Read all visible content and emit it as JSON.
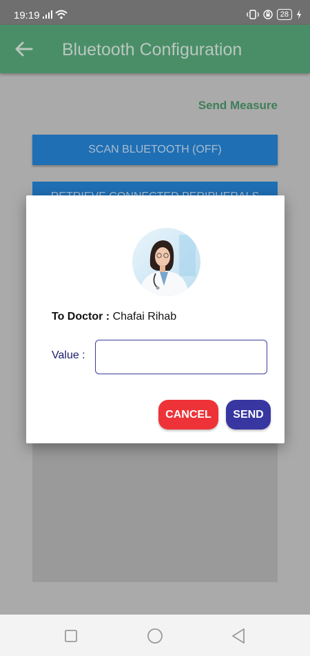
{
  "status_bar": {
    "time": "19:19",
    "battery": "28"
  },
  "app_bar": {
    "title": "Bluetooth Configuration",
    "back_icon": "arrow-left-icon",
    "color": "#4a8e68"
  },
  "screen": {
    "send_measure": "Send Measure",
    "scan_button": "SCAN BLUETOOTH (OFF)",
    "retrieve_button": "RETRIEVE CONNECTED PERIPHERALS"
  },
  "dialog": {
    "doctor_label": "To Doctor :",
    "doctor_name": "Chafai Rihab",
    "value_label": "Value :",
    "value_input": "",
    "cancel_label": "CANCEL",
    "send_label": "SEND",
    "cancel_color": "#ee3338",
    "send_color": "#3836a1"
  },
  "nav_bar": {
    "icons": [
      "square-icon",
      "circle-icon",
      "triangle-back-icon"
    ]
  }
}
